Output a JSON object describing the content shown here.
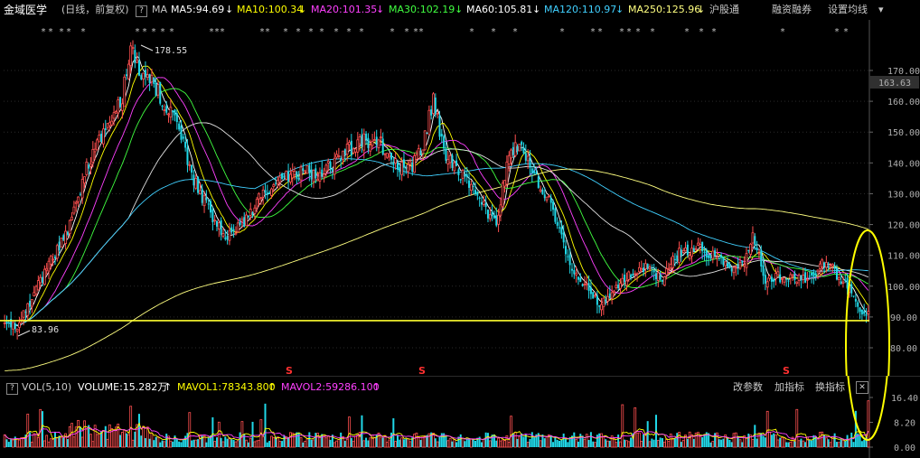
{
  "header": {
    "stock_name": "金域医学",
    "period": "(日线，前复权)",
    "help": "?",
    "ma_label": "MA",
    "ma": [
      {
        "label": "MA5:94.69",
        "color": "#ffffff",
        "arrow": "↓"
      },
      {
        "label": "MA10:100.34",
        "color": "#ffff00",
        "arrow": "↓"
      },
      {
        "label": "MA20:101.35",
        "color": "#ff40ff",
        "arrow": "↓"
      },
      {
        "label": "MA30:102.19",
        "color": "#40ff40",
        "arrow": "↓"
      },
      {
        "label": "MA60:105.81",
        "color": "#ffffff",
        "arrow": "↓"
      },
      {
        "label": "MA120:110.97",
        "color": "#40d0ff",
        "arrow": "↓"
      },
      {
        "label": "MA250:125.96",
        "color": "#ffff80",
        "arrow": "↓"
      }
    ],
    "buttons": [
      "沪股通",
      "融资融券",
      "设置均线"
    ],
    "settings_arrow": "▾"
  },
  "price_axis": {
    "ticks": [
      "170.00",
      "160.00",
      "150.00",
      "140.00",
      "130.00",
      "120.00",
      "110.00",
      "100.00",
      "90.00",
      "80.00"
    ],
    "current_price": "163.63"
  },
  "annotations": {
    "high": "178.55",
    "low": "83.96",
    "s_marks": [
      "S",
      "S",
      "S"
    ]
  },
  "volume_header": {
    "help": "?",
    "title": "VOL(5,10)",
    "volume": "VOLUME:15.282万",
    "volume_arrow": "↑",
    "mavol1": "MAVOL1:78343.800",
    "mavol1_arrow": "↑",
    "mavol2": "MAVOL2:59286.100",
    "mavol2_arrow": "↑",
    "buttons": [
      "改参数",
      "加指标",
      "换指标"
    ],
    "close": "✕"
  },
  "volume_axis": {
    "ticks": [
      "16.40",
      "8.20",
      "0.00"
    ]
  },
  "colors": {
    "up": "#ff5050",
    "down": "#20d8e8",
    "support_line": "#ffff30",
    "highlight": "#ffff00"
  },
  "chart_data": {
    "type": "candlestick",
    "ylim": [
      73,
      185
    ],
    "support_level": 88.8,
    "high_marker": 178.55,
    "low_marker": 83.96,
    "anchors_close": [
      [
        0,
        88
      ],
      [
        6,
        86
      ],
      [
        12,
        95
      ],
      [
        22,
        108
      ],
      [
        30,
        118
      ],
      [
        38,
        136
      ],
      [
        44,
        148
      ],
      [
        50,
        152
      ],
      [
        56,
        162
      ],
      [
        60,
        176
      ],
      [
        64,
        170
      ],
      [
        68,
        168
      ],
      [
        72,
        164
      ],
      [
        78,
        158
      ],
      [
        84,
        148
      ],
      [
        90,
        135
      ],
      [
        96,
        126
      ],
      [
        104,
        116
      ],
      [
        112,
        119
      ],
      [
        120,
        127
      ],
      [
        130,
        134
      ],
      [
        140,
        137
      ],
      [
        150,
        136
      ],
      [
        160,
        142
      ],
      [
        168,
        146
      ],
      [
        176,
        148
      ],
      [
        184,
        142
      ],
      [
        192,
        137
      ],
      [
        198,
        143
      ],
      [
        204,
        160
      ],
      [
        210,
        141
      ],
      [
        218,
        136
      ],
      [
        226,
        127
      ],
      [
        234,
        120
      ],
      [
        240,
        142
      ],
      [
        246,
        146
      ],
      [
        252,
        137
      ],
      [
        260,
        126
      ],
      [
        268,
        108
      ],
      [
        276,
        100
      ],
      [
        284,
        94
      ],
      [
        290,
        98
      ],
      [
        298,
        104
      ],
      [
        306,
        106
      ],
      [
        312,
        102
      ],
      [
        320,
        110
      ],
      [
        330,
        113
      ],
      [
        338,
        109
      ],
      [
        346,
        106
      ],
      [
        352,
        109
      ],
      [
        356,
        117
      ],
      [
        362,
        101
      ],
      [
        368,
        103
      ],
      [
        376,
        102
      ],
      [
        384,
        102
      ],
      [
        390,
        108
      ],
      [
        396,
        104
      ],
      [
        402,
        99
      ],
      [
        408,
        92
      ]
    ],
    "volume_ylim": [
      0,
      18
    ],
    "volume_ticks": [
      16.4,
      8.2,
      0
    ]
  }
}
